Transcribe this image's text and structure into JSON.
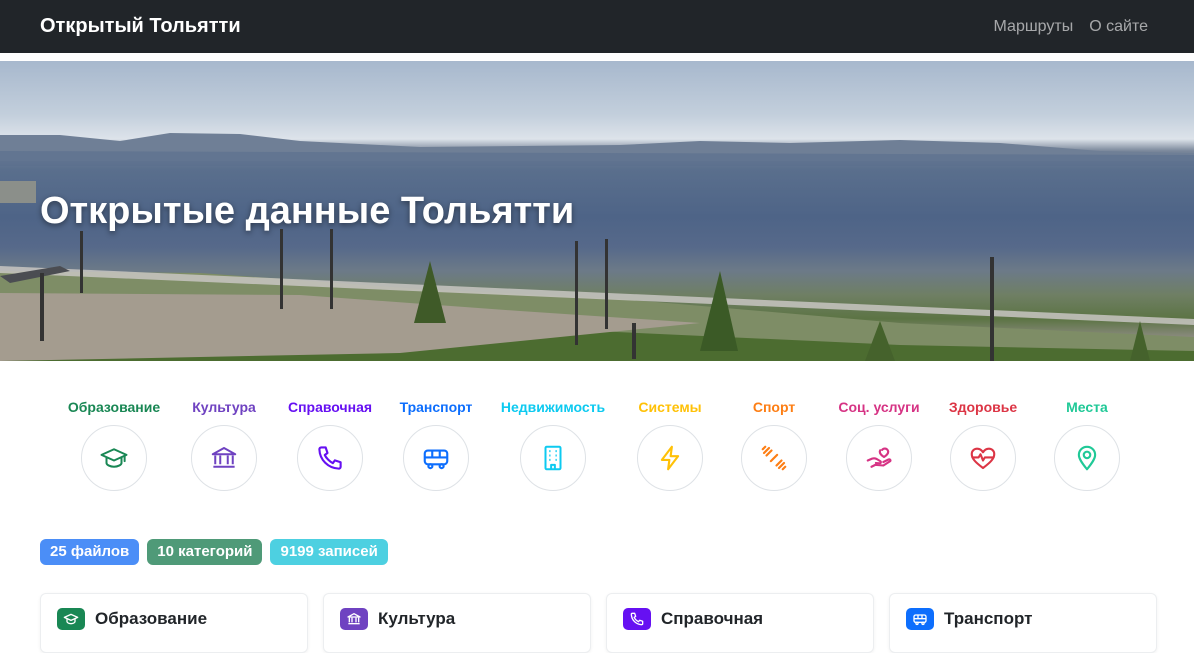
{
  "navbar": {
    "brand": "Открытый Тольятти",
    "links": [
      "Маршруты",
      "О сайте"
    ]
  },
  "hero": {
    "title": "Открытые данные Тольятти"
  },
  "categories": [
    {
      "label": "Образование",
      "icon": "graduation-cap-icon",
      "color": "#198754"
    },
    {
      "label": "Культура",
      "icon": "museum-icon",
      "color": "#6f42c1"
    },
    {
      "label": "Справочная",
      "icon": "phone-icon",
      "color": "#6610f2"
    },
    {
      "label": "Транспорт",
      "icon": "bus-icon",
      "color": "#0d6efd"
    },
    {
      "label": "Недвижимость",
      "icon": "building-icon",
      "color": "#0dcaf0"
    },
    {
      "label": "Системы",
      "icon": "lightning-icon",
      "color": "#ffc107"
    },
    {
      "label": "Спорт",
      "icon": "dumbbell-icon",
      "color": "#fd7e14"
    },
    {
      "label": "Соц. услуги",
      "icon": "hand-heart-icon",
      "color": "#d63384"
    },
    {
      "label": "Здоровье",
      "icon": "heart-pulse-icon",
      "color": "#dc3545"
    },
    {
      "label": "Места",
      "icon": "map-pin-icon",
      "color": "#20c997"
    }
  ],
  "stats": [
    {
      "label": "25 файлов",
      "color": "#4b8ef7"
    },
    {
      "label": "10 категорий",
      "color": "#4f9a78"
    },
    {
      "label": "9199 записей",
      "color": "#4dd0e1"
    }
  ],
  "cards": [
    {
      "title": "Образование",
      "icon": "graduation-cap-icon",
      "color": "#198754"
    },
    {
      "title": "Культура",
      "icon": "museum-icon",
      "color": "#6f42c1"
    },
    {
      "title": "Справочная",
      "icon": "phone-icon",
      "color": "#6610f2"
    },
    {
      "title": "Транспорт",
      "icon": "bus-icon",
      "color": "#0d6efd"
    }
  ]
}
